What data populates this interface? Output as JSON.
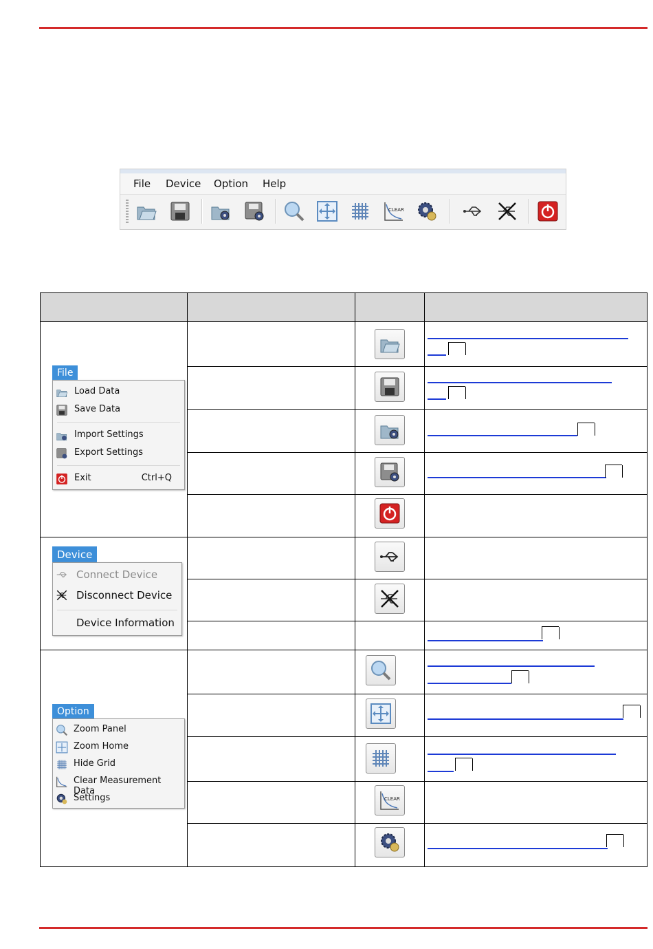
{
  "toolbar_window": {
    "menus": [
      "File",
      "Device",
      "Option",
      "Help"
    ],
    "toolbar_icons": [
      "load-data-icon",
      "save-data-icon",
      "import-settings-icon",
      "export-settings-icon",
      "zoom-panel-icon",
      "zoom-home-icon",
      "hide-grid-icon",
      "clear-measurement-data-icon",
      "settings-icon",
      "connect-device-icon",
      "disconnect-device-icon",
      "exit-icon"
    ]
  },
  "file_menu": {
    "title": "File",
    "items": [
      {
        "label": "Load Data",
        "icon": "load-data-icon",
        "shortcut": ""
      },
      {
        "label": "Save Data",
        "icon": "save-data-icon",
        "shortcut": ""
      },
      {
        "label": "Import Settings",
        "icon": "import-settings-icon",
        "shortcut": ""
      },
      {
        "label": "Export Settings",
        "icon": "export-settings-icon",
        "shortcut": ""
      },
      {
        "label": "Exit",
        "icon": "exit-icon",
        "shortcut": "Ctrl+Q"
      }
    ]
  },
  "device_menu": {
    "title": "Device",
    "items": [
      {
        "label": "Connect Device",
        "icon": "connect-device-icon",
        "disabled": true
      },
      {
        "label": "Disconnect Device",
        "icon": "disconnect-device-icon",
        "disabled": false
      },
      {
        "label": "Device Information",
        "icon": "",
        "disabled": false
      }
    ]
  },
  "option_menu": {
    "title": "Option",
    "items": [
      {
        "label": "Zoom Panel",
        "icon": "zoom-panel-icon"
      },
      {
        "label": "Zoom Home",
        "icon": "zoom-home-icon"
      },
      {
        "label": "Hide Grid",
        "icon": "hide-grid-icon"
      },
      {
        "label": "Clear Measurement Data",
        "icon": "clear-measurement-data-icon"
      },
      {
        "label": "Settings",
        "icon": "settings-icon"
      }
    ]
  },
  "colors": {
    "rule": "#d42a2a",
    "link": "#1c3ad6",
    "header_bg": "#d8d8d8",
    "menu_tab": "#3d8fd9"
  }
}
